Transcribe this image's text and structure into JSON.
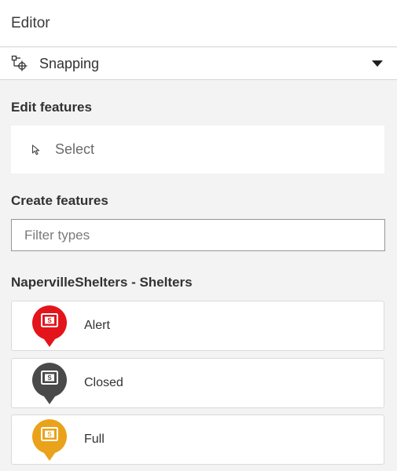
{
  "header": {
    "title": "Editor"
  },
  "snapping": {
    "label": "Snapping",
    "icon": "snapping-icon",
    "expanded": false
  },
  "edit": {
    "heading": "Edit features",
    "select_label": "Select",
    "icon": "cursor-icon"
  },
  "create": {
    "heading": "Create features",
    "filter": {
      "placeholder": "Filter types",
      "value": ""
    }
  },
  "layer": {
    "title": "NapervilleShelters - Shelters",
    "types": [
      {
        "label": "Alert",
        "color": "#e3151b",
        "icon": "shelter-marker-icon"
      },
      {
        "label": "Closed",
        "color": "#4a4a4a",
        "icon": "shelter-marker-icon"
      },
      {
        "label": "Full",
        "color": "#e9a21a",
        "icon": "shelter-marker-icon"
      }
    ]
  }
}
